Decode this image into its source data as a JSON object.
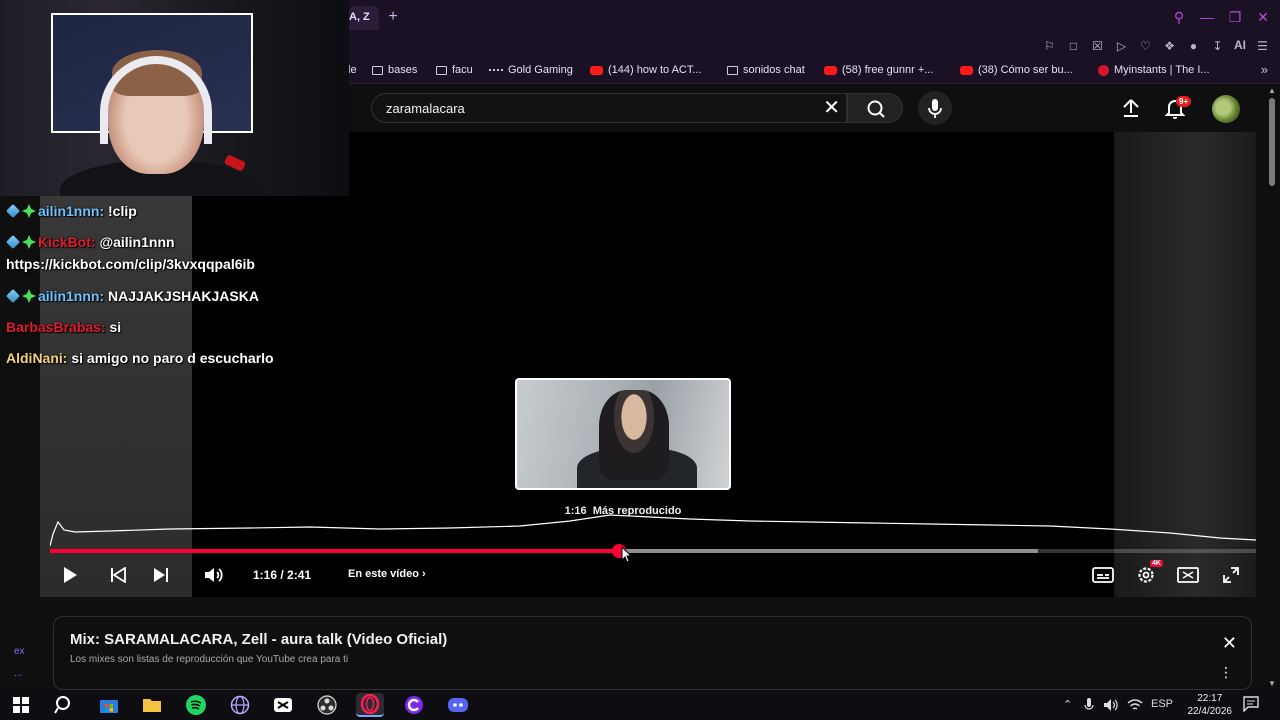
{
  "browser": {
    "active_tab_label": "A, Z",
    "new_tab": "+",
    "ai_label": "AI"
  },
  "bookmarks": [
    {
      "label": "le",
      "icon": "none"
    },
    {
      "label": "bases",
      "icon": "folder-icon"
    },
    {
      "label": "facu",
      "icon": "folder-icon"
    },
    {
      "label": "Gold Gaming",
      "icon": "dots-icon"
    },
    {
      "label": "(144) how to ACT...",
      "icon": "youtube-icon"
    },
    {
      "label": "sonidos chat",
      "icon": "folder-icon"
    },
    {
      "label": "(58) free gunnr +...",
      "icon": "youtube-icon"
    },
    {
      "label": "(38) Cómo ser bu...",
      "icon": "youtube-icon"
    },
    {
      "label": "Myinstants | The I...",
      "icon": "circle-icon"
    }
  ],
  "youtube": {
    "search_value": "zaramalacara",
    "notification_count": "9+",
    "accent": "#ff0033"
  },
  "player": {
    "preview_time": "1:16",
    "preview_label": "Más reproducido",
    "current_time": "1:16",
    "duration": "2:41",
    "time_display": "1:16 / 2:41",
    "chapter_label": "En este vídeo",
    "progress_fraction": 0.472,
    "buffered_fraction": 0.819,
    "quality_badge": "4K"
  },
  "mix": {
    "title": "Mix: SARAMALACARA, Zell - aura talk (Video Oficial)",
    "subtitle": "Los mixes son listas de reproducción que YouTube crea para ti"
  },
  "chat": [
    {
      "user": "ailin1nnn:",
      "message": "!clip",
      "color": "#6fc2ff",
      "badges": true
    },
    {
      "user": "KickBot:",
      "message": "@ailin1nnn",
      "color": "#e01b2e",
      "badges": true
    },
    {
      "user": "",
      "message": "https://kickbot.com/clip/3kvxqqpal6ib",
      "color": "#ffffff",
      "badges": false
    },
    {
      "user": "ailin1nnn:",
      "message": "NAJJAKJSHAKJASKA",
      "color": "#6fc2ff",
      "badges": true
    },
    {
      "user": "BarbasBrabas:",
      "message": "si",
      "color": "#e01b2e",
      "badges": false
    },
    {
      "user": "AldiNani:",
      "message": "si amigo no paro d escucharlo",
      "color": "#f5d37a",
      "badges": false
    }
  ],
  "left_rail": {
    "item1": "ex",
    "item2": "..."
  },
  "taskbar": {
    "language": "ESP",
    "time": "22:17",
    "date": "22/4/2026"
  }
}
